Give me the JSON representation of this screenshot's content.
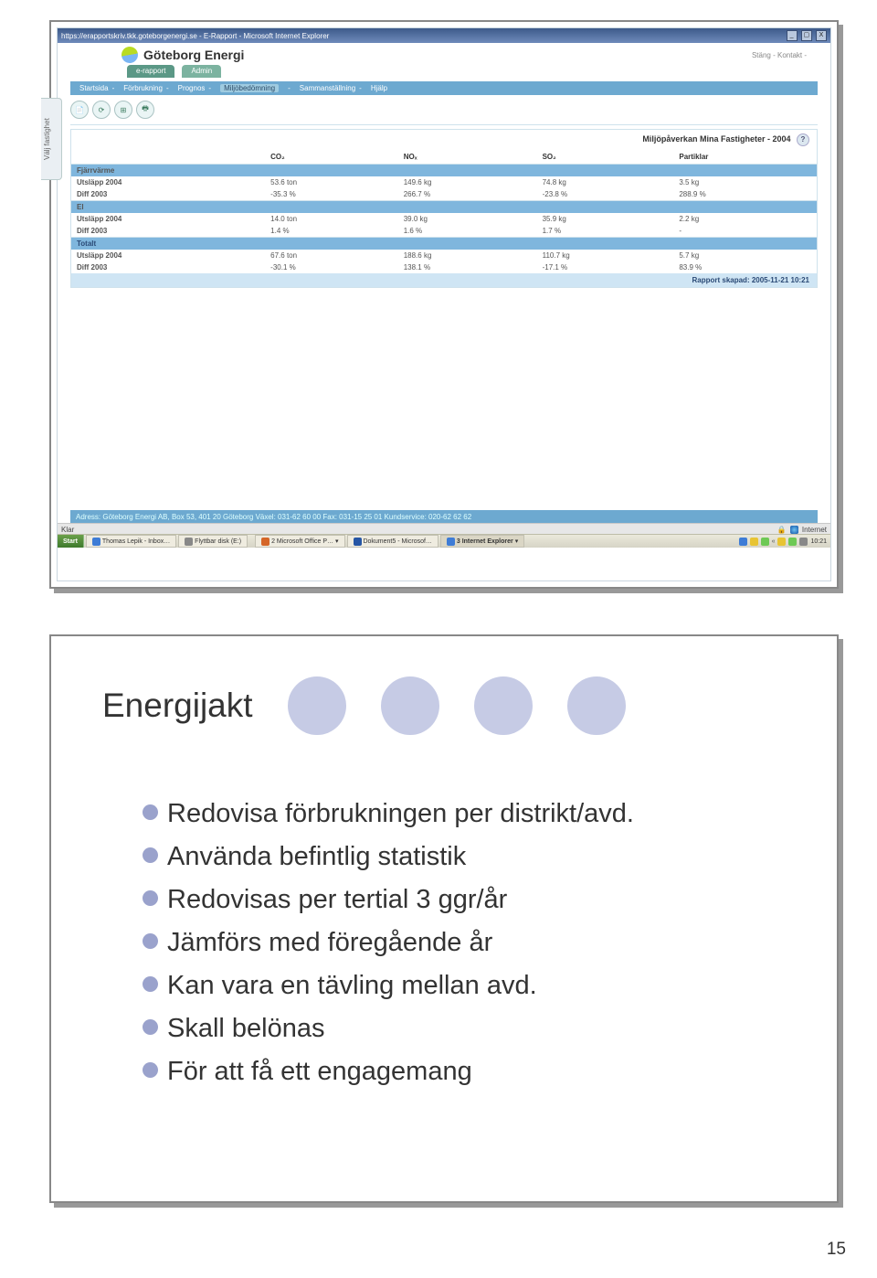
{
  "ie": {
    "title": "https://erapportskriv.tkk.goteborgenergi.se - E-Rapport - Microsoft Internet Explorer",
    "status": "Klar",
    "zone": "Internet"
  },
  "brand": {
    "name": "Göteborg Energi",
    "right_links": "Stäng  -  Kontakt  -"
  },
  "tabs": {
    "erapport": "e-rapport",
    "admin": "Admin"
  },
  "menu": {
    "startsida": "Startsida",
    "forbrukning": "Förbrukning",
    "prognos": "Prognos",
    "miljobedomning": "Miljöbedömning",
    "sammanstallning": "Sammanställning",
    "hjalp": "Hjälp"
  },
  "side_tab": "Välj fastighet",
  "report": {
    "title": "Miljöpåverkan Mina Fastigheter - 2004",
    "columns": {
      "co2": "CO₂",
      "nox": "NOₓ",
      "so2": "SO₂",
      "partiklar": "Partiklar"
    },
    "sections": [
      {
        "name": "Fjärrvärme",
        "rows": [
          {
            "label": "Utsläpp 2004",
            "co2": "53.6 ton",
            "nox": "149.6 kg",
            "so2": "74.8 kg",
            "part": "3.5 kg"
          },
          {
            "label": "Diff 2003",
            "co2": "-35.3 %",
            "nox": "266.7 %",
            "so2": "-23.8 %",
            "part": "288.9 %"
          }
        ]
      },
      {
        "name": "El",
        "rows": [
          {
            "label": "Utsläpp 2004",
            "co2": "14.0 ton",
            "nox": "39.0 kg",
            "so2": "35.9 kg",
            "part": "2.2 kg"
          },
          {
            "label": "Diff 2003",
            "co2": "1.4 %",
            "nox": "1.6 %",
            "so2": "1.7 %",
            "part": "-"
          }
        ]
      },
      {
        "name": "Totalt",
        "rows": [
          {
            "label": "Utsläpp 2004",
            "co2": "67.6 ton",
            "nox": "188.6 kg",
            "so2": "110.7 kg",
            "part": "5.7 kg"
          },
          {
            "label": "Diff 2003",
            "co2": "-30.1 %",
            "nox": "138.1 %",
            "so2": "-17.1 %",
            "part": "83.9 %"
          }
        ]
      }
    ],
    "footer": "Rapport skapad: 2005-11-21 10:21"
  },
  "address_bar": "Adress: Göteborg Energi AB, Box 53, 401 20 Göteborg   Växel: 031-62 60 00   Fax: 031-15 25 01   Kundservice: 020-62 62 62",
  "taskbar": {
    "start": "Start",
    "items": [
      "Thomas Lepik - Inbox…",
      "Flyttbar disk (E:)",
      "2 Microsoft Office P…",
      "Dokument5 - Microsof…",
      "3 Internet Explorer"
    ],
    "clock": "10:21"
  },
  "slide2": {
    "title": "Energijakt",
    "bullets": [
      "Redovisa förbrukningen per distrikt/avd.",
      "Använda befintlig statistik",
      "Redovisas per tertial 3 ggr/år",
      "Jämförs med föregående år",
      "Kan vara en tävling mellan avd.",
      "Skall belönas",
      "För att få ett engagemang"
    ]
  },
  "page_number": "15"
}
